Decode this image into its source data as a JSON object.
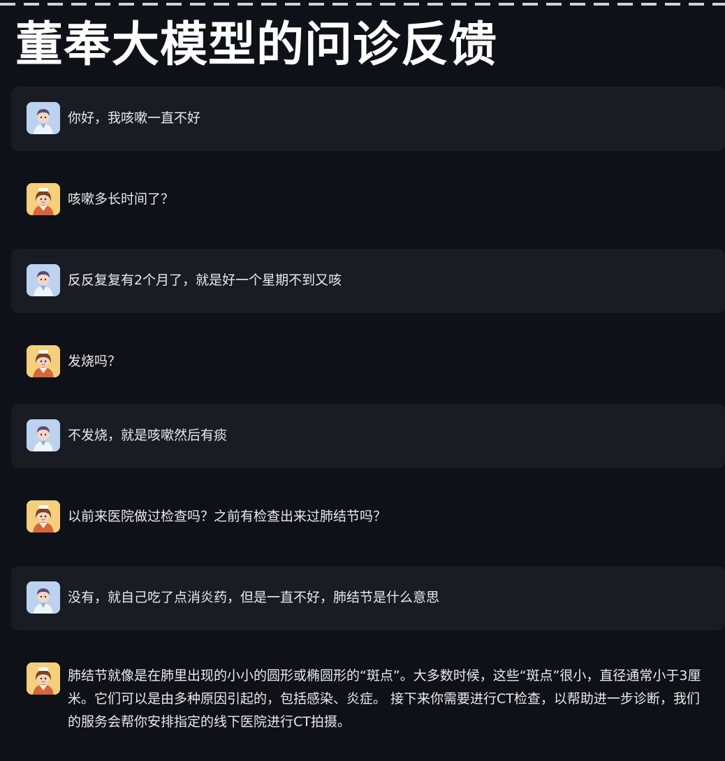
{
  "page": {
    "title": "董奉大模型的问诊反馈"
  },
  "colors": {
    "background": "#0e1117",
    "user_bubble": "#1a1c24",
    "user_avatar_bg": "#bcd3ef",
    "doctor_avatar_bg": "#f5cf7a"
  },
  "chat": {
    "messages": [
      {
        "role": "user",
        "avatar_icon": "patient-avatar-icon",
        "text": "你好，我咳嗽一直不好"
      },
      {
        "role": "doctor",
        "avatar_icon": "doctor-avatar-icon",
        "text": "咳嗽多长时间了？"
      },
      {
        "role": "user",
        "avatar_icon": "patient-avatar-icon",
        "text": "反反复复有2个月了，就是好一个星期不到又咳"
      },
      {
        "role": "doctor",
        "avatar_icon": "doctor-avatar-icon",
        "text": "发烧吗？"
      },
      {
        "role": "user",
        "avatar_icon": "patient-avatar-icon",
        "text": "不发烧，就是咳嗽然后有痰"
      },
      {
        "role": "doctor",
        "avatar_icon": "doctor-avatar-icon",
        "text": "以前来医院做过检查吗？之前有检查出来过肺结节吗？"
      },
      {
        "role": "user",
        "avatar_icon": "patient-avatar-icon",
        "text": "没有，就自己吃了点消炎药，但是一直不好，肺结节是什么意思"
      },
      {
        "role": "doctor",
        "avatar_icon": "doctor-avatar-icon",
        "text": "肺结节就像是在肺里出现的小小的圆形或椭圆形的“斑点”。大多数时候，这些“斑点”很小，直径通常小于3厘米。它们可以是由多种原因引起的，包括感染、炎症。 接下来你需要进行CT检查，以帮助进一步诊断，我们的服务会帮你安排指定的线下医院进行CT拍摄。"
      }
    ]
  }
}
